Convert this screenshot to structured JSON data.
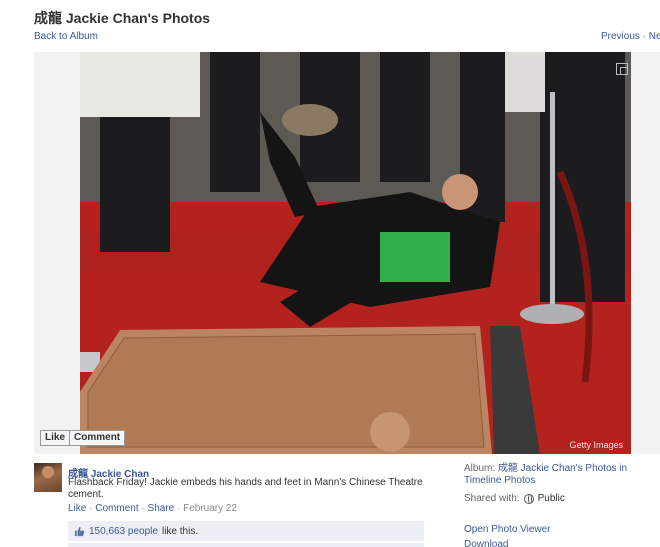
{
  "header": {
    "title": "成龍 Jackie Chan's Photos",
    "back_link": "Back to Album",
    "prev_next": "Previous · Next"
  },
  "photo": {
    "credit": "Getty Images",
    "like_button": "Like",
    "comment_button": "Comment"
  },
  "post": {
    "author": "成龍 Jackie Chan",
    "caption": "Flashback Friday! Jackie embeds his hands and feet in Mann's Chinese Theatre cement.",
    "actions": {
      "like": "Like",
      "comment": "Comment",
      "share": "Share",
      "separator": "·",
      "date": "February 22"
    },
    "likes": {
      "count": "150,663 people",
      "suffix": "like this."
    }
  },
  "sidebar": {
    "album_prefix": "Album:",
    "album_name": "成龍 Jackie Chan's Photos in Timeline Photos",
    "shared_label": "Shared with:",
    "shared_value": "Public",
    "open_viewer": "Open Photo Viewer",
    "download": "Download"
  },
  "colors": {
    "link": "#3b5998",
    "likes_bg": "#eceff5",
    "carpet": "#b4221e",
    "cement": "#b07a55"
  }
}
